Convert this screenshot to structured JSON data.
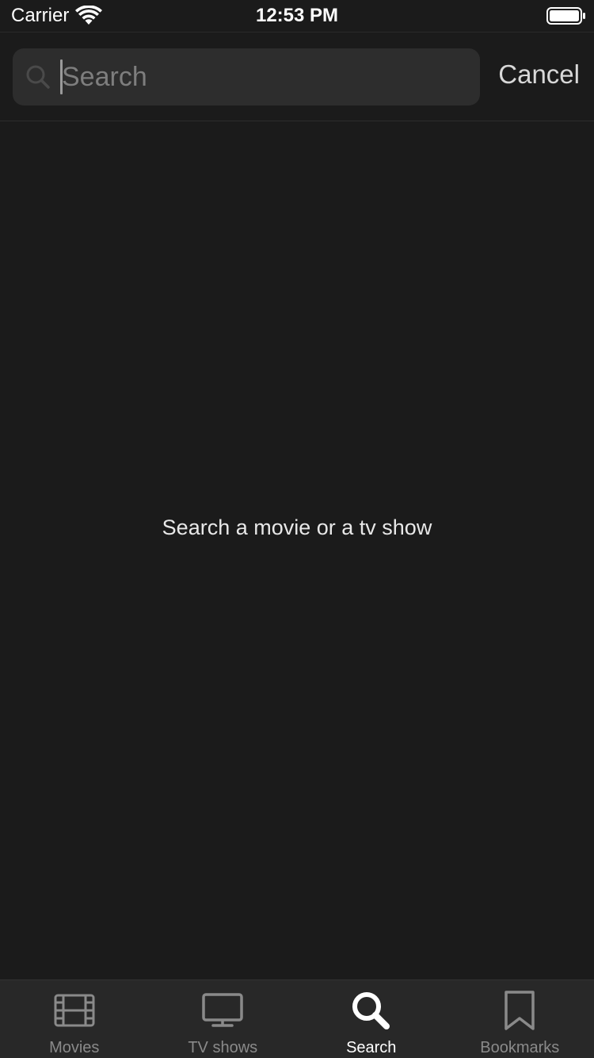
{
  "status_bar": {
    "carrier": "Carrier",
    "time": "12:53 PM"
  },
  "search": {
    "placeholder": "Search",
    "value": "",
    "cancel_label": "Cancel"
  },
  "empty_state": {
    "message": "Search a movie or a tv show"
  },
  "tab_bar": {
    "tabs": [
      {
        "label": "Movies",
        "icon": "film-icon",
        "active": false
      },
      {
        "label": "TV shows",
        "icon": "tv-icon",
        "active": false
      },
      {
        "label": "Search",
        "icon": "search-icon",
        "active": true
      },
      {
        "label": "Bookmarks",
        "icon": "bookmark-icon",
        "active": false
      }
    ]
  },
  "colors": {
    "background": "#1b1b1b",
    "search_field": "#2d2d2d",
    "tab_bar": "#282828",
    "tab_inactive": "#8a8a8a",
    "tab_active": "#ffffff"
  }
}
